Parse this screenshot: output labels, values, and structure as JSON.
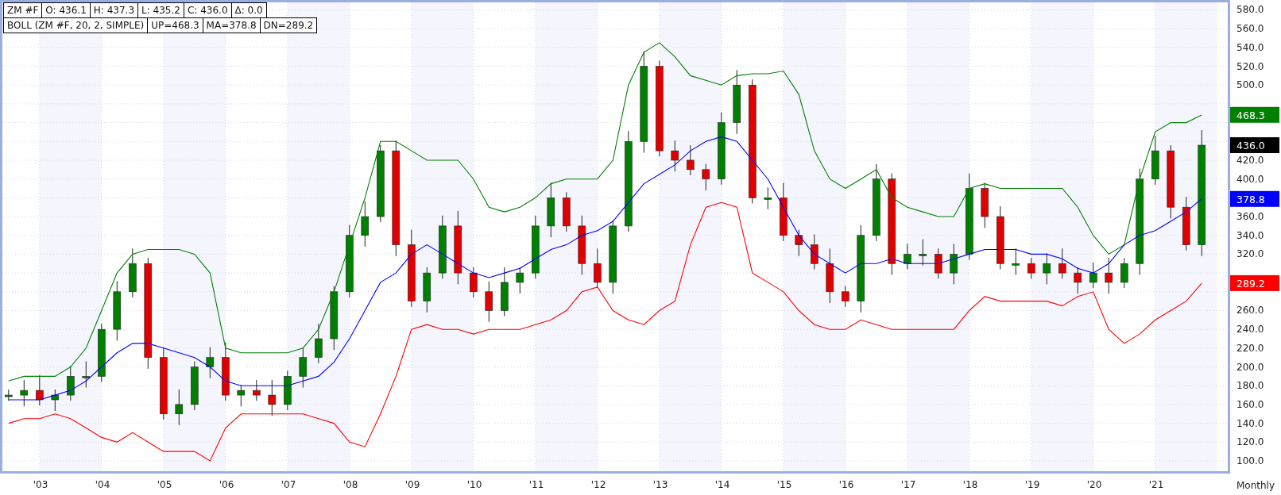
{
  "legend": {
    "row_1": [
      "ZM #F",
      "O: 436.1",
      "H: 437.3",
      "L: 435.2",
      "C: 436.0",
      "Δ: 0.0"
    ],
    "row_2": [
      "BOLL (ZM #F, 20, 2, SIMPLE)",
      "UP=468.3",
      "MA=378.8",
      "DN=289.2"
    ]
  },
  "chart": {
    "chart_data": {
      "type": "candlestick",
      "grid": true,
      "xlim": [
        2002.4,
        2022.17
      ],
      "ylim": [
        89,
        588
      ],
      "x": [
        2002.5,
        2002.75,
        2003,
        2003.25,
        2003.5,
        2003.75,
        2004,
        2004.25,
        2004.5,
        2004.75,
        2005,
        2005.25,
        2005.5,
        2005.75,
        2006,
        2006.25,
        2006.5,
        2006.75,
        2007,
        2007.25,
        2007.5,
        2007.75,
        2008,
        2008.25,
        2008.5,
        2008.75,
        2009,
        2009.25,
        2009.5,
        2009.75,
        2010,
        2010.25,
        2010.5,
        2010.75,
        2011,
        2011.25,
        2011.5,
        2011.75,
        2012,
        2012.25,
        2012.5,
        2012.75,
        2013,
        2013.25,
        2013.5,
        2013.75,
        2014,
        2014.25,
        2014.5,
        2014.75,
        2015,
        2015.25,
        2015.5,
        2015.75,
        2016,
        2016.25,
        2016.5,
        2016.75,
        2017,
        2017.25,
        2017.5,
        2017.75,
        2018,
        2018.25,
        2018.5,
        2018.75,
        2019,
        2019.25,
        2019.5,
        2019.75,
        2020,
        2020.25,
        2020.5,
        2020.75,
        2021,
        2021.25,
        2021.5,
        2021.75
      ],
      "ohlc": [
        [
          170,
          176,
          164,
          170
        ],
        [
          170,
          186,
          158,
          175
        ],
        [
          175,
          191,
          159,
          165
        ],
        [
          165,
          176,
          153,
          170
        ],
        [
          170,
          201,
          164,
          190
        ],
        [
          190,
          206,
          178,
          190
        ],
        [
          190,
          246,
          184,
          240
        ],
        [
          240,
          291,
          228,
          280
        ],
        [
          280,
          326,
          274,
          310
        ],
        [
          310,
          316,
          198,
          210
        ],
        [
          210,
          221,
          144,
          150
        ],
        [
          150,
          176,
          138,
          160
        ],
        [
          160,
          206,
          154,
          200
        ],
        [
          200,
          221,
          188,
          210
        ],
        [
          210,
          226,
          164,
          170
        ],
        [
          170,
          181,
          158,
          175
        ],
        [
          175,
          186,
          164,
          170
        ],
        [
          170,
          186,
          148,
          160
        ],
        [
          160,
          196,
          154,
          190
        ],
        [
          190,
          221,
          178,
          210
        ],
        [
          210,
          246,
          204,
          230
        ],
        [
          230,
          286,
          218,
          280
        ],
        [
          280,
          351,
          274,
          340
        ],
        [
          340,
          376,
          328,
          360
        ],
        [
          360,
          436,
          354,
          430
        ],
        [
          430,
          441,
          318,
          330
        ],
        [
          330,
          346,
          264,
          270
        ],
        [
          270,
          306,
          258,
          300
        ],
        [
          300,
          361,
          294,
          350
        ],
        [
          350,
          366,
          288,
          300
        ],
        [
          300,
          306,
          274,
          280
        ],
        [
          280,
          291,
          248,
          260
        ],
        [
          260,
          306,
          254,
          290
        ],
        [
          290,
          306,
          278,
          300
        ],
        [
          300,
          361,
          294,
          350
        ],
        [
          350,
          396,
          338,
          380
        ],
        [
          380,
          386,
          344,
          350
        ],
        [
          350,
          361,
          298,
          310
        ],
        [
          310,
          326,
          284,
          290
        ],
        [
          290,
          356,
          278,
          350
        ],
        [
          350,
          451,
          344,
          440
        ],
        [
          440,
          536,
          428,
          520
        ],
        [
          520,
          526,
          424,
          430
        ],
        [
          430,
          441,
          408,
          420
        ],
        [
          420,
          436,
          404,
          410
        ],
        [
          410,
          416,
          388,
          400
        ],
        [
          400,
          471,
          394,
          460
        ],
        [
          460,
          516,
          448,
          500
        ],
        [
          500,
          506,
          374,
          380
        ],
        [
          380,
          391,
          368,
          380
        ],
        [
          380,
          396,
          334,
          340
        ],
        [
          340,
          346,
          318,
          330
        ],
        [
          330,
          341,
          304,
          310
        ],
        [
          310,
          326,
          268,
          280
        ],
        [
          280,
          286,
          264,
          270
        ],
        [
          270,
          351,
          258,
          340
        ],
        [
          340,
          416,
          334,
          400
        ],
        [
          400,
          406,
          298,
          310
        ],
        [
          310,
          331,
          304,
          320
        ],
        [
          320,
          336,
          308,
          320
        ],
        [
          320,
          326,
          294,
          300
        ],
        [
          300,
          331,
          288,
          320
        ],
        [
          320,
          406,
          314,
          390
        ],
        [
          390,
          396,
          348,
          360
        ],
        [
          360,
          371,
          304,
          310
        ],
        [
          310,
          326,
          298,
          310
        ],
        [
          310,
          316,
          294,
          300
        ],
        [
          300,
          321,
          288,
          310
        ],
        [
          310,
          326,
          294,
          300
        ],
        [
          300,
          306,
          278,
          290
        ],
        [
          290,
          311,
          284,
          300
        ],
        [
          300,
          316,
          278,
          290
        ],
        [
          290,
          316,
          284,
          310
        ],
        [
          310,
          411,
          298,
          400
        ],
        [
          400,
          446,
          394,
          430
        ],
        [
          430,
          436,
          358,
          370
        ],
        [
          370,
          381,
          324,
          330
        ],
        [
          330,
          452,
          318,
          436
        ]
      ],
      "series": [
        {
          "type": "line",
          "color": "#008000",
          "values": [
            185,
            190,
            190,
            190,
            200,
            220,
            260,
            300,
            320,
            325,
            325,
            325,
            320,
            300,
            220,
            215,
            215,
            215,
            215,
            220,
            240,
            280,
            330,
            380,
            440,
            440,
            430,
            420,
            420,
            420,
            400,
            370,
            365,
            370,
            380,
            395,
            400,
            400,
            400,
            420,
            500,
            535,
            545,
            530,
            510,
            505,
            500,
            510,
            512,
            512,
            515,
            490,
            430,
            400,
            390,
            400,
            410,
            380,
            370,
            365,
            360,
            360,
            390,
            395,
            390,
            390,
            390,
            390,
            390,
            370,
            340,
            320,
            330,
            400,
            450,
            460,
            460,
            468
          ]
        },
        {
          "type": "line",
          "color": "#0000ff",
          "values": [
            165,
            165,
            165,
            170,
            175,
            185,
            200,
            215,
            225,
            225,
            220,
            215,
            210,
            200,
            185,
            180,
            180,
            180,
            180,
            185,
            190,
            205,
            230,
            260,
            290,
            300,
            320,
            330,
            320,
            310,
            300,
            295,
            300,
            305,
            315,
            325,
            330,
            340,
            345,
            355,
            375,
            395,
            405,
            415,
            430,
            440,
            445,
            440,
            420,
            400,
            370,
            340,
            320,
            310,
            300,
            310,
            310,
            315,
            310,
            310,
            310,
            315,
            320,
            325,
            325,
            325,
            320,
            320,
            315,
            305,
            300,
            310,
            330,
            340,
            345,
            355,
            365,
            379
          ]
        },
        {
          "type": "line",
          "color": "#ff0000",
          "values": [
            140,
            145,
            145,
            150,
            145,
            135,
            125,
            120,
            130,
            120,
            110,
            110,
            110,
            100,
            135,
            150,
            150,
            150,
            150,
            150,
            145,
            140,
            120,
            115,
            150,
            190,
            240,
            245,
            240,
            240,
            235,
            240,
            240,
            240,
            245,
            250,
            260,
            280,
            285,
            260,
            250,
            245,
            260,
            270,
            330,
            370,
            375,
            370,
            300,
            290,
            280,
            260,
            245,
            240,
            240,
            250,
            245,
            240,
            240,
            240,
            240,
            240,
            260,
            275,
            270,
            270,
            270,
            270,
            265,
            275,
            280,
            240,
            225,
            235,
            250,
            260,
            270,
            289
          ]
        }
      ],
      "xticks": [
        {
          "value": 2003,
          "label": "'03"
        },
        {
          "value": 2004,
          "label": "'04"
        },
        {
          "value": 2005,
          "label": "'05"
        },
        {
          "value": 2006,
          "label": "'06"
        },
        {
          "value": 2007,
          "label": "'07"
        },
        {
          "value": 2008,
          "label": "'08"
        },
        {
          "value": 2009,
          "label": "'09"
        },
        {
          "value": 2010,
          "label": "'10"
        },
        {
          "value": 2011,
          "label": "'11"
        },
        {
          "value": 2012,
          "label": "'12"
        },
        {
          "value": 2013,
          "label": "'13"
        },
        {
          "value": 2014,
          "label": "'14"
        },
        {
          "value": 2015,
          "label": "'15"
        },
        {
          "value": 2016,
          "label": "'16"
        },
        {
          "value": 2017,
          "label": "'17"
        },
        {
          "value": 2018,
          "label": "'18"
        },
        {
          "value": 2019,
          "label": "'19"
        },
        {
          "value": 2020,
          "label": "'20"
        },
        {
          "value": 2021,
          "label": "'21"
        }
      ],
      "yticks": [
        {
          "value": 100,
          "label": "100.0"
        },
        {
          "value": 120,
          "label": "120.0"
        },
        {
          "value": 140,
          "label": "140.0"
        },
        {
          "value": 160,
          "label": "160.0"
        },
        {
          "value": 180,
          "label": "180.0"
        },
        {
          "value": 200,
          "label": "200.0"
        },
        {
          "value": 220,
          "label": "220.0"
        },
        {
          "value": 240,
          "label": "240.0"
        },
        {
          "value": 260,
          "label": "260.0"
        },
        {
          "value": 320,
          "label": "320.0"
        },
        {
          "value": 340,
          "label": "340.0"
        },
        {
          "value": 360,
          "label": "360.0"
        },
        {
          "value": 400,
          "label": "400.0"
        },
        {
          "value": 420,
          "label": "420.0"
        },
        {
          "value": 500,
          "label": "500.0"
        },
        {
          "value": 520,
          "label": "520.0"
        },
        {
          "value": 540,
          "label": "540.0"
        },
        {
          "value": 560,
          "label": "560.0"
        },
        {
          "value": 580,
          "label": "580.0"
        }
      ]
    }
  },
  "axis_tags": [
    {
      "label": "468.3",
      "color": "#008000"
    },
    {
      "label": "436.0",
      "color": "#000000"
    },
    {
      "label": "378.8",
      "color": "#0000ff"
    },
    {
      "label": "289.2",
      "color": "#ff0000"
    }
  ],
  "timeframe": "Monthly"
}
